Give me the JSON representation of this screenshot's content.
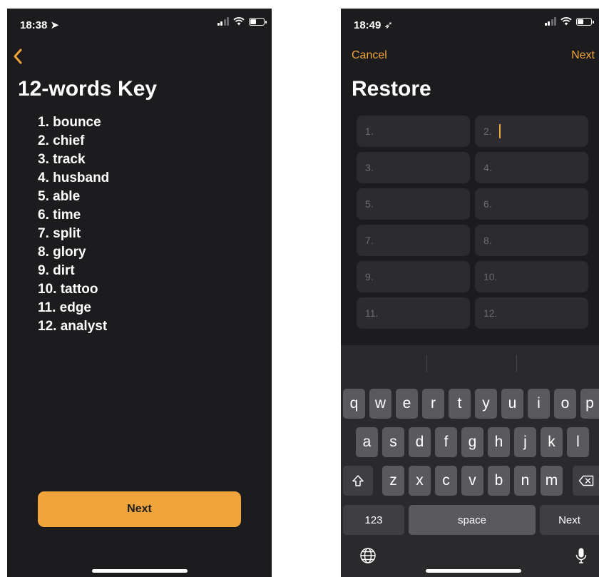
{
  "left_screen": {
    "status": {
      "time": "18:38 ➤"
    },
    "title": "12-words Key",
    "words": [
      "1. bounce",
      "2. chief",
      "3. track",
      "4. husband",
      "5. able",
      "6. time",
      "7. split",
      "8. glory",
      "9. dirt",
      "10. tattoo",
      "11. edge",
      "12. analyst"
    ],
    "next_label": "Next"
  },
  "right_screen": {
    "status": {
      "time": "18:49 ➶"
    },
    "cancel_label": "Cancel",
    "next_label": "Next",
    "title": "Restore",
    "fields": [
      "1.",
      "2.",
      "3.",
      "4.",
      "5.",
      "6.",
      "7.",
      "8.",
      "9.",
      "10.",
      "11.",
      "12."
    ],
    "active_field": 2
  },
  "keyboard": {
    "row1": [
      "q",
      "w",
      "e",
      "r",
      "t",
      "y",
      "u",
      "i",
      "o",
      "p"
    ],
    "row2": [
      "a",
      "s",
      "d",
      "f",
      "g",
      "h",
      "j",
      "k",
      "l"
    ],
    "row3": [
      "z",
      "x",
      "c",
      "v",
      "b",
      "n",
      "m"
    ],
    "numbers_label": "123",
    "space_label": "space",
    "return_label": "Next",
    "icons": [
      "shift-icon",
      "backspace-icon",
      "globe-icon",
      "microphone-icon"
    ]
  },
  "colors": {
    "accent": "#f0a53c",
    "background": "#1c1c1e",
    "field": "#2c2c30",
    "key": "#5a5a5e"
  }
}
